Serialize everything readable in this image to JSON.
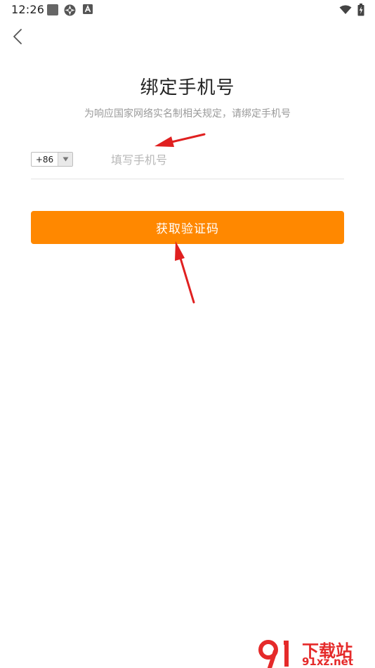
{
  "status_bar": {
    "time": "12:26"
  },
  "page": {
    "title": "绑定手机号",
    "subtitle": "为响应国家网络实名制相关规定，请绑定手机号"
  },
  "phone": {
    "country_code": "+86",
    "placeholder": "填写手机号"
  },
  "button": {
    "label": "获取验证码"
  },
  "watermark": {
    "line1": "下载站",
    "line2": "91xz.net"
  },
  "colors": {
    "accent": "#ff8800",
    "annotation_arrow": "#e02020",
    "watermark": "#e52a2a"
  }
}
